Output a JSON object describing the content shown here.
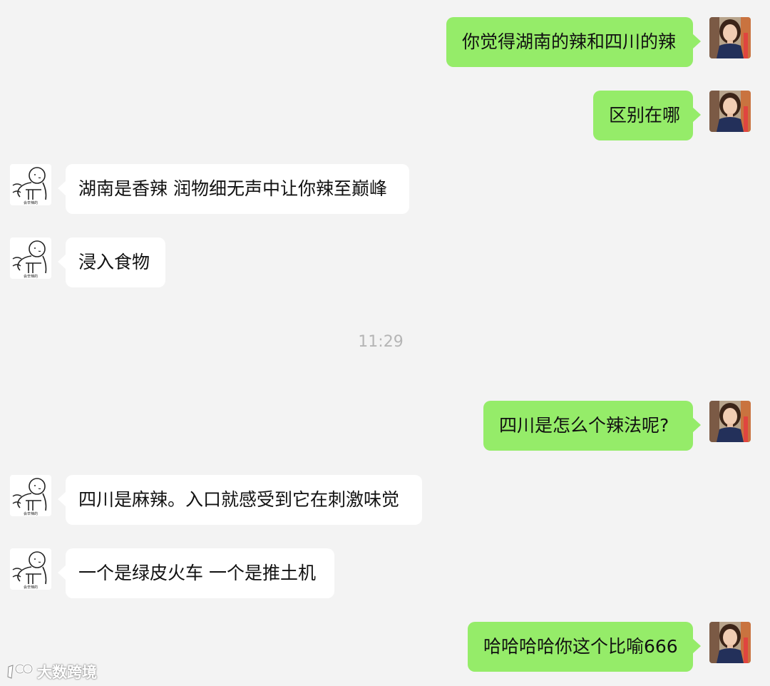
{
  "conversation": {
    "messages": [
      {
        "sender": "me",
        "text": "你觉得湖南的辣和四川的辣"
      },
      {
        "sender": "me",
        "text": "区别在哪"
      },
      {
        "sender": "friend",
        "text": "湖南是香辣 润物细无声中让你辣至巅峰"
      },
      {
        "sender": "friend",
        "text": "浸入食物"
      },
      {
        "sender": "me",
        "text": "四川是怎么个辣法呢?"
      },
      {
        "sender": "friend",
        "text": "四川是麻辣。入口就感受到它在刺激味觉"
      },
      {
        "sender": "friend",
        "text": "一个是绿皮火车 一个是推土机"
      },
      {
        "sender": "me",
        "text": "哈哈哈哈你这个比喻666"
      }
    ],
    "timestamp": "11:29"
  },
  "avatars": {
    "me": "photo-avatar",
    "friend": "stick-figure-avatar",
    "friend_caption": "会辛辣的"
  },
  "watermark": {
    "text": "大数跨境",
    "icon": "logo-icon"
  },
  "colors": {
    "background": "#f3f3f3",
    "outgoing_bubble": "#95ec69",
    "incoming_bubble": "#ffffff",
    "timestamp": "#b5b5b5"
  }
}
